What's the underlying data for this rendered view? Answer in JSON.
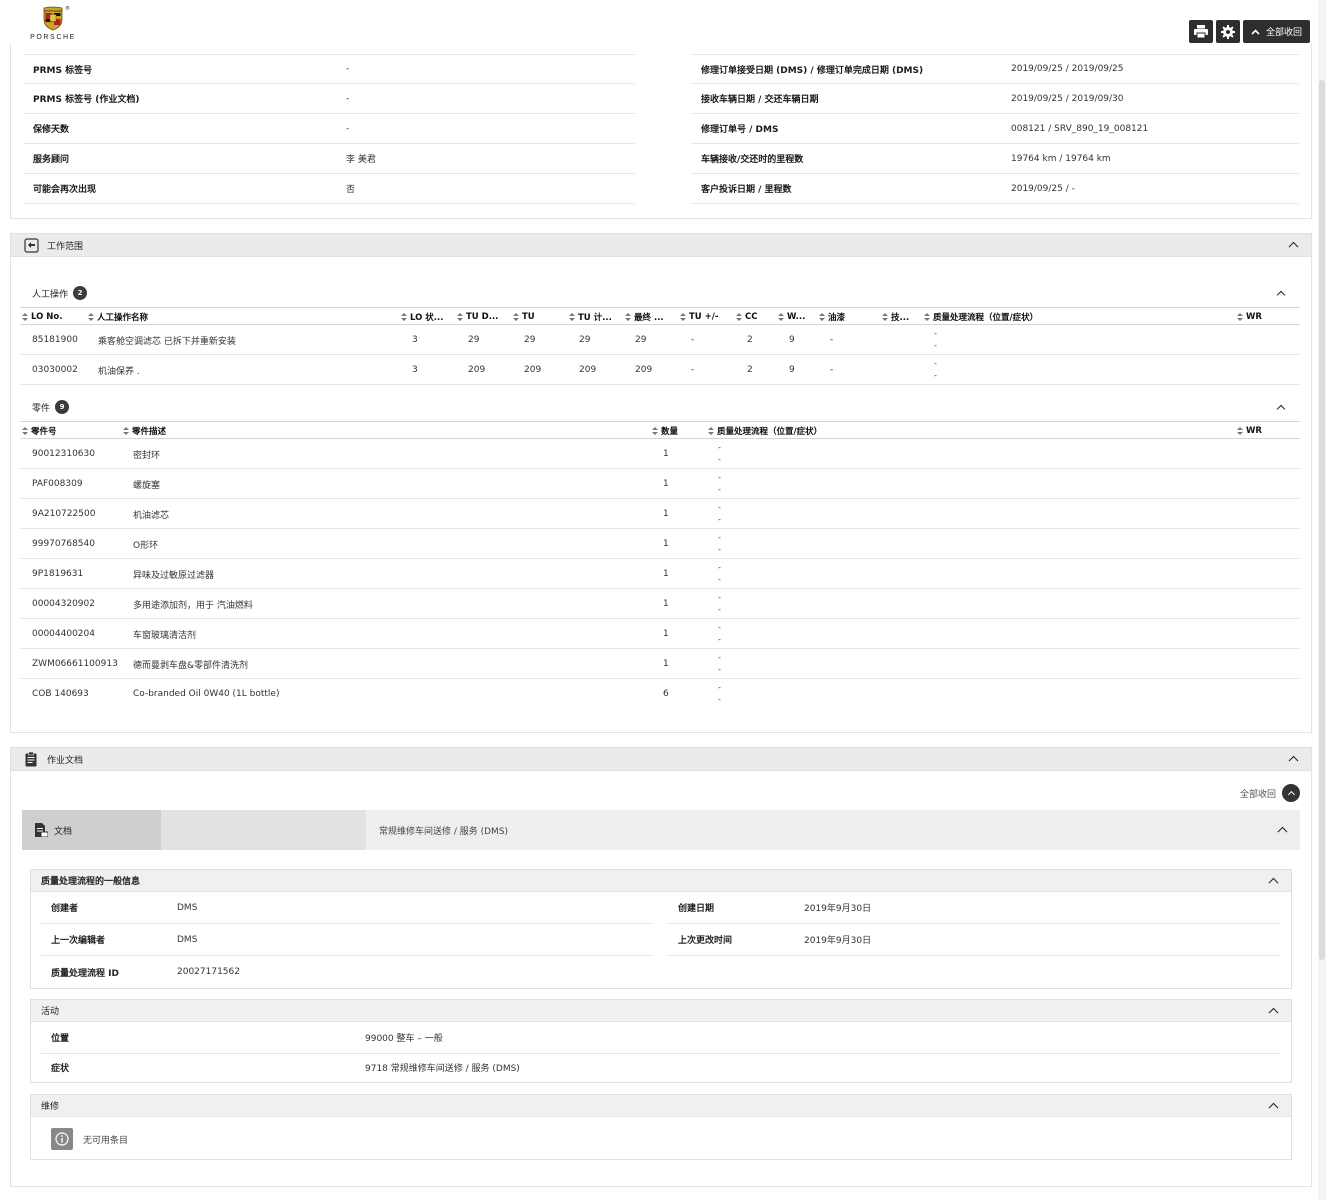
{
  "brand": {
    "wordmark": "PORSCHE",
    "reg": "®"
  },
  "toolbar": {
    "collapse_all_label": "全部收回"
  },
  "info": {
    "left": [
      {
        "key": "PRMS 标签号",
        "value": "-"
      },
      {
        "key": "PRMS 标签号 (作业文档)",
        "value": "-"
      },
      {
        "key": "保修天数",
        "value": "-"
      },
      {
        "key": "服务顾问",
        "value": "李 美君"
      },
      {
        "key": "可能会再次出现",
        "value": "否"
      }
    ],
    "right": [
      {
        "key": "修理订单接受日期 (DMS) / 修理订单完成日期 (DMS)",
        "value": "2019/09/25 / 2019/09/25"
      },
      {
        "key": "接收车辆日期 / 交还车辆日期",
        "value": "2019/09/25 / 2019/09/30"
      },
      {
        "key": "修理订单号 / DMS",
        "value": "008121 / SRV_890_19_008121"
      },
      {
        "key": "车辆接收/交还时的里程数",
        "value": "19764 km / 19764 km"
      },
      {
        "key": "客户投诉日期 / 里程数",
        "value": "2019/09/25 / -"
      }
    ]
  },
  "work_scope": {
    "title": "工作范围",
    "labor": {
      "title": "人工操作",
      "count": "2",
      "columns": [
        "LO No.",
        "人工操作名称",
        "LO 状...",
        "TU D...",
        "TU",
        "TU 计...",
        "最终 ...",
        "TU +/-",
        "CC",
        "W...",
        "油漆",
        "技...",
        "质量处理流程（位置/症状）",
        "WR"
      ],
      "rows": [
        {
          "lo_no": "85181900",
          "name": "乘客舱空调滤芯 已拆下并重新安装",
          "lo_status": "3",
          "tu_d": "29",
          "tu": "29",
          "tu_calc": "29",
          "final": "29",
          "tu_pm": "-",
          "cc": "2",
          "w": "9",
          "paint": "-",
          "qp1": "-",
          "qp2": "-"
        },
        {
          "lo_no": "03030002",
          "name": "机油保养 .",
          "lo_status": "3",
          "tu_d": "209",
          "tu": "209",
          "tu_calc": "209",
          "final": "209",
          "tu_pm": "-",
          "cc": "2",
          "w": "9",
          "paint": "-",
          "qp1": "-",
          "qp2": "-"
        }
      ]
    },
    "parts": {
      "title": "零件",
      "count": "9",
      "columns": [
        "零件号",
        "零件描述",
        "数量",
        "质量处理流程（位置/症状）",
        "WR"
      ],
      "rows": [
        {
          "no": "90012310630",
          "desc": "密封环",
          "qty": "1",
          "qp1": "-",
          "qp2": "-"
        },
        {
          "no": "PAF008309",
          "desc": "螺旋塞",
          "qty": "1",
          "qp1": "-",
          "qp2": "-"
        },
        {
          "no": "9A210722500",
          "desc": "机油滤芯",
          "qty": "1",
          "qp1": "-",
          "qp2": "-"
        },
        {
          "no": "99970768540",
          "desc": "O形环",
          "qty": "1",
          "qp1": "-",
          "qp2": "-"
        },
        {
          "no": "9P1819631",
          "desc": "异味及过敏原过滤器",
          "qty": "1",
          "qp1": "-",
          "qp2": "-"
        },
        {
          "no": "00004320902",
          "desc": "多用途添加剂，用于 汽油燃料",
          "qty": "1",
          "qp1": "-",
          "qp2": "-"
        },
        {
          "no": "00004400204",
          "desc": "车窗玻璃清洁剂",
          "qty": "1",
          "qp1": "-",
          "qp2": "-"
        },
        {
          "no": "ZWM06661100913",
          "desc": "德而曼剥车盘&零部件清洗剂",
          "qty": "1",
          "qp1": "-",
          "qp2": "-"
        },
        {
          "no": "COB 140693",
          "desc": "Co-branded Oil 0W40 (1L bottle)",
          "qty": "6",
          "qp1": "-",
          "qp2": "-"
        }
      ]
    }
  },
  "work_docs": {
    "title": "作业文档",
    "collapse_all": "全部收回",
    "tab_label": "文档",
    "doc_title": "常规维修车间送修 / 服务 (DMS)",
    "general": {
      "title": "质量处理流程的一般信息",
      "created_by_key": "创建者",
      "created_by": "DMS",
      "created_date_key": "创建日期",
      "created_date": "2019年9月30日",
      "last_editor_key": "上一次编辑者",
      "last_editor": "DMS",
      "last_change_key": "上次更改时间",
      "last_change": "2019年9月30日",
      "qp_id_key": "质量处理流程 ID",
      "qp_id": "20027171562"
    },
    "activity": {
      "title": "活动",
      "location_key": "位置",
      "location": "99000 整车 – 一般",
      "symptom_key": "症状",
      "symptom": "9718 常规维修车间送修 / 服务 (DMS)"
    },
    "repair": {
      "title": "维修",
      "empty": "无可用条目"
    }
  }
}
